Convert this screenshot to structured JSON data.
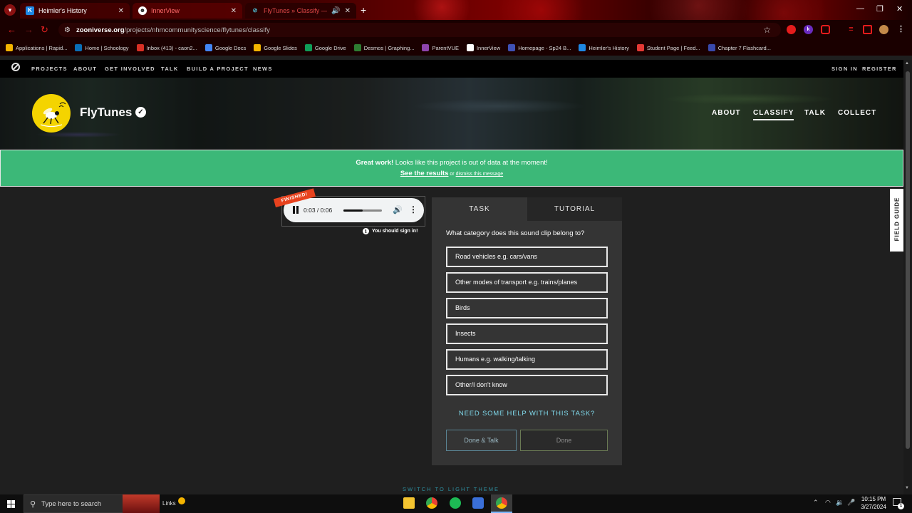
{
  "browser": {
    "tabs": [
      {
        "title": "Heimler's History",
        "favicon": "K"
      },
      {
        "title": "InnerView",
        "favicon": "☻"
      },
      {
        "title": "FlyTunes » Classify — Zoo",
        "favicon": "⊘"
      }
    ],
    "url_host": "zooniverse.org",
    "url_path": "/projects/nhmcommunityscience/flytunes/classify",
    "extensions": [
      "k"
    ],
    "bookmarks": [
      {
        "label": "Applications | Rapid...",
        "color": "#f4b400"
      },
      {
        "label": "Home | Schoology",
        "color": "#0a6fb7"
      },
      {
        "label": "Inbox (413) - caon2...",
        "color": "#d93025"
      },
      {
        "label": "Google Docs",
        "color": "#4285f4"
      },
      {
        "label": "Google Slides",
        "color": "#f4b400"
      },
      {
        "label": "Google Drive",
        "color": "#0f9d58"
      },
      {
        "label": "Desmos | Graphing...",
        "color": "#2e7d32"
      },
      {
        "label": "ParentVUE",
        "color": "#8e44ad"
      },
      {
        "label": "InnerView",
        "color": "#ffffff"
      },
      {
        "label": "Homepage - Sp24 B...",
        "color": "#3f51b5"
      },
      {
        "label": "Heimler's History",
        "color": "#1e88e5"
      },
      {
        "label": "Student Page | Feed...",
        "color": "#e53935"
      },
      {
        "label": "Chapter 7 Flashcard...",
        "color": "#3949ab"
      }
    ]
  },
  "zoo_nav": {
    "links": [
      "PROJECTS",
      "ABOUT",
      "GET INVOLVED",
      "TALK",
      "BUILD A PROJECT",
      "NEWS"
    ],
    "sign_in": "SIGN IN",
    "register": "REGISTER"
  },
  "project": {
    "title": "FlyTunes",
    "nav": [
      "ABOUT",
      "CLASSIFY",
      "TALK",
      "COLLECT"
    ],
    "active_nav": "CLASSIFY"
  },
  "banner": {
    "bold": "Great work!",
    "message": " Looks like this project is out of data at the moment!",
    "see_results": "See the results",
    "or": " or ",
    "dismiss": "dismiss this message"
  },
  "player": {
    "ribbon": "FINISHED!",
    "time": "0:03 / 0:06",
    "progress": 0.5,
    "signin_note": "You should sign in!"
  },
  "task": {
    "tab_task": "TASK",
    "tab_tutorial": "TUTORIAL",
    "question": "What category does this sound clip belong to?",
    "answers": [
      "Road vehicles e.g. cars/vans",
      "Other modes of transport e.g. trains/planes",
      "Birds",
      "Insects",
      "Humans e.g. walking/talking",
      "Other/I don't know"
    ],
    "help": "NEED SOME HELP WITH THIS TASK?",
    "done_talk": "Done & Talk",
    "done": "Done"
  },
  "field_guide": "FIELD GUIDE",
  "theme_toggle": "SWITCH TO LIGHT THEME",
  "taskbar": {
    "search_placeholder": "Type here to search",
    "links": "Links",
    "time": "10:15 PM",
    "date": "3/27/2024",
    "notifications": "1"
  },
  "colors": {
    "banner": "#3cb878",
    "panel": "#343434",
    "accent_link": "#7fd8ea",
    "ribbon": "#e8421e",
    "avatar": "#f4d400"
  }
}
